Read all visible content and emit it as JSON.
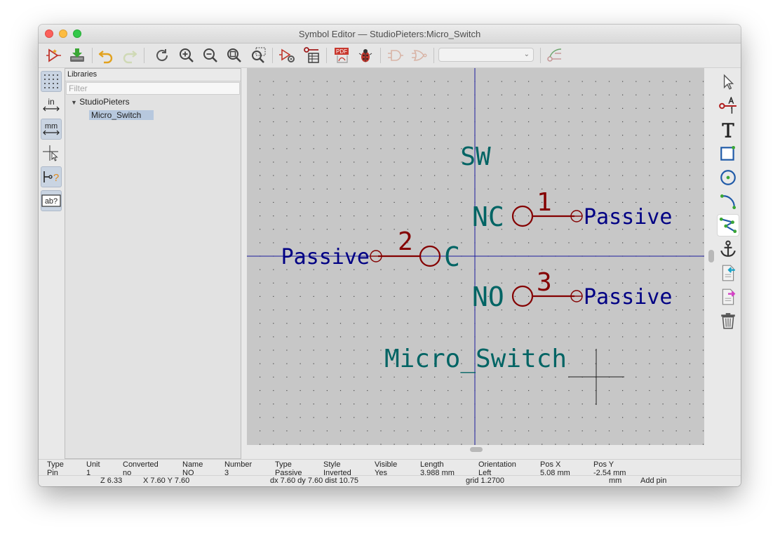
{
  "window": {
    "title": "Symbol Editor — StudioPieters:Micro_Switch"
  },
  "toolbar": {
    "pdf_label": "PDF",
    "unit_select_value": ""
  },
  "left_toolbar": {
    "in_label": "in",
    "mm_label": "mm",
    "pin_label": "?",
    "ab_label": "ab?"
  },
  "libraries": {
    "header": "Libraries",
    "filter_placeholder": "Filter",
    "tree": {
      "library": "StudioPieters",
      "symbol": "Micro_Switch"
    }
  },
  "symbol": {
    "reference": "SW",
    "value": "Micro_Switch",
    "pins": [
      {
        "name": "NC",
        "number": "1",
        "type": "Passive"
      },
      {
        "name": "C",
        "number": "2",
        "type": "Passive"
      },
      {
        "name": "NO",
        "number": "3",
        "type": "Passive"
      }
    ]
  },
  "message_panel": [
    {
      "label": "Type",
      "value": "Pin"
    },
    {
      "label": "Unit",
      "value": "1"
    },
    {
      "label": "Converted",
      "value": "no"
    },
    {
      "label": "Name",
      "value": "NO"
    },
    {
      "label": "Number",
      "value": "3"
    },
    {
      "label": "Type",
      "value": "Passive"
    },
    {
      "label": "Style",
      "value": "Inverted"
    },
    {
      "label": "Visible",
      "value": "Yes"
    },
    {
      "label": "Length",
      "value": "3.988 mm"
    },
    {
      "label": "Orientation",
      "value": "Left"
    },
    {
      "label": "Pos X",
      "value": "5.08 mm"
    },
    {
      "label": "Pos Y",
      "value": "-2.54 mm"
    }
  ],
  "status": {
    "zoom": "Z 6.33",
    "xy": "X 7.60  Y 7.60",
    "delta": "dx 7.60  dy 7.60  dist 10.75",
    "grid": "grid 1.2700",
    "units": "mm",
    "tool": "Add pin"
  },
  "colors": {
    "pin": "#840000",
    "pin_type": "#000084",
    "field": "#006464",
    "axis": "#1c1c9c",
    "canvas": "#c7c7c7"
  }
}
